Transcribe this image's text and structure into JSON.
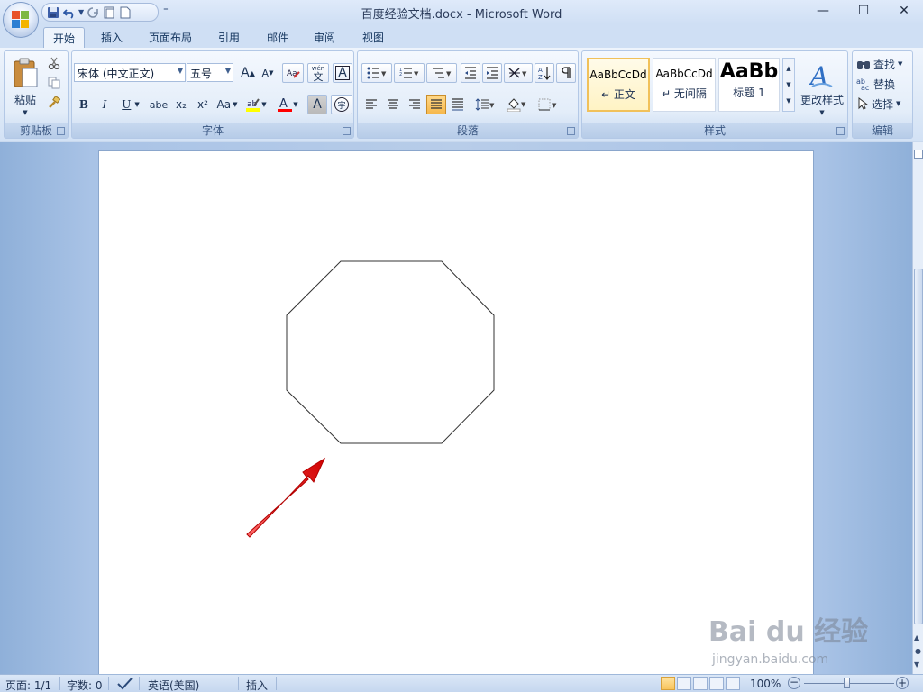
{
  "window": {
    "title": "百度经验文档.docx - Microsoft Word",
    "minimize": "—",
    "maximize": "☐",
    "close": "✕"
  },
  "qat": {
    "more": "⁼"
  },
  "tabs": [
    {
      "label": "开始",
      "active": true
    },
    {
      "label": "插入"
    },
    {
      "label": "页面布局"
    },
    {
      "label": "引用"
    },
    {
      "label": "邮件"
    },
    {
      "label": "审阅"
    },
    {
      "label": "视图"
    }
  ],
  "ribbon": {
    "clipboard": {
      "label": "剪贴板",
      "paste": "粘贴"
    },
    "font": {
      "label": "字体",
      "font_name": "宋体 (中文正文)",
      "font_size": "五号",
      "grow": "A",
      "shrink": "A",
      "bold": "B",
      "italic": "I",
      "underline": "U",
      "strike": "abe",
      "sub": "x₂",
      "sup": "x²",
      "case": "Aa",
      "phonetic": "wén",
      "phonetic_char": "文",
      "border_char": "A",
      "shade_char": "A",
      "enclose_char": "字"
    },
    "paragraph": {
      "label": "段落"
    },
    "styles": {
      "label": "样式",
      "items": [
        {
          "sample": "AaBbCcDd",
          "name": "↵ 正文"
        },
        {
          "sample": "AaBbCcDd",
          "name": "↵ 无间隔"
        },
        {
          "sample": "AaBb",
          "name": "标题 1"
        }
      ],
      "change": "更改样式"
    },
    "editing": {
      "label": "编辑",
      "find": "查找",
      "replace": "替换",
      "select": "选择"
    }
  },
  "statusbar": {
    "page": "页面: 1/1",
    "words": "字数: 0",
    "language": "英语(美国)",
    "mode": "插入",
    "zoom": "100%"
  },
  "watermark": {
    "main": "Bai du 经验",
    "sub": "jingyan.baidu.com"
  },
  "colors": {
    "arrow": "#e8151b",
    "highlight": "#ffff00",
    "font_color": "#ff0000"
  }
}
